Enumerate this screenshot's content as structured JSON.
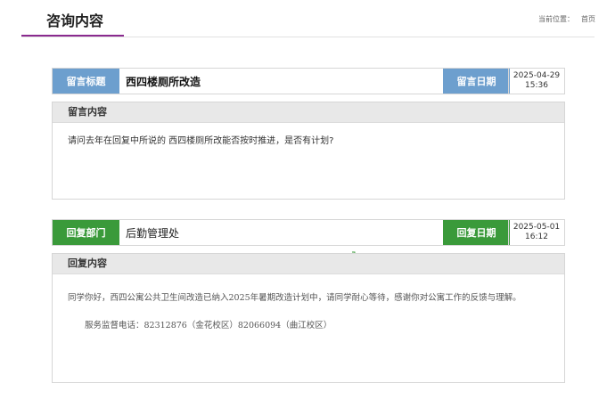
{
  "header": {
    "title": "咨询内容",
    "breadcrumb_label": "当前位置：",
    "breadcrumb_home": "首页"
  },
  "message": {
    "title_label": "留言标题",
    "title_value": "西四楼厕所改造",
    "date_label": "留言日期",
    "date": "2025-04-29",
    "time": "15:36",
    "content_label": "留言内容",
    "content": "请问去年在回复中所说的 西四楼厕所改能否按时推进，是否有计划?"
  },
  "reply": {
    "dept_label": "回复部门",
    "dept_value": "后勤管理处",
    "date_label": "回复日期",
    "date": "2025-05-01",
    "time": "16:12",
    "content_label": "回复内容",
    "content": "同学你好，西四公寓公共卫生间改造已纳入2025年暑期改造计划中，请同学耐心等待，感谢你对公寓工作的反馈与理解。",
    "phone": "服务监督电话：82312876（金花校区）82066094（曲江校区）"
  },
  "colors": {
    "accent_purple": "#8a2a8f",
    "message_label_bg": "#6d9fce",
    "reply_label_bg": "#3a9a3a",
    "section_head_bg": "#e8e8e8"
  },
  "icons": {
    "document": "document-icon"
  }
}
